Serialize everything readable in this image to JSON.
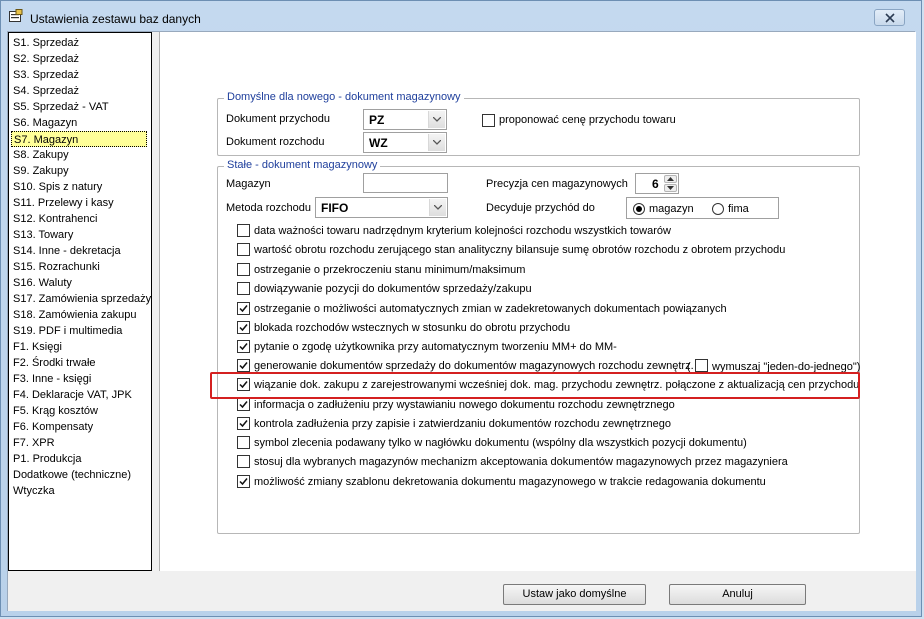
{
  "window": {
    "title": "Ustawienia zestawu baz danych"
  },
  "sections": [
    "S1. Sprzedaż",
    "S2. Sprzedaż",
    "S3. Sprzedaż",
    "S4. Sprzedaż",
    "S5. Sprzedaż - VAT",
    "S6. Magazyn",
    "S7. Magazyn",
    "S8. Zakupy",
    "S9. Zakupy",
    "S10. Spis z natury",
    "S11. Przelewy i kasy",
    "S12. Kontrahenci",
    "S13. Towary",
    "S14. Inne - dekretacja",
    "S15. Rozrachunki",
    "S16. Waluty",
    "S17. Zamówienia sprzedaży",
    "S18. Zamówienia zakupu",
    "S19. PDF i multimedia",
    "F1. Księgi",
    "F2. Środki trwałe",
    "F3. Inne - księgi",
    "F4. Deklaracje VAT, JPK",
    "F5. Krąg kosztów",
    "F6. Kompensaty",
    "F7. XPR",
    "P1. Produkcja",
    "Dodatkowe (techniczne)",
    "Wtyczka"
  ],
  "selected_section": "S7. Magazyn",
  "defaults_group": {
    "legend": "Domyślne dla nowego - dokument magazynowy",
    "income_doc_label": "Dokument przychodu",
    "income_doc_value": "PZ",
    "outgo_doc_label": "Dokument rozchodu",
    "outgo_doc_value": "WZ",
    "propose_price_label": "proponować cenę przychodu towaru"
  },
  "fixed_group": {
    "legend": "Stałe - dokument magazynowy",
    "warehouse_label": "Magazyn",
    "warehouse_value": "",
    "precision_label": "Precyzja cen magazynowych",
    "precision_value": "6",
    "method_label": "Metoda rozchodu",
    "method_value": "FIFO",
    "decides_label": "Decyduje przychód do",
    "radio_warehouse": "magazyn",
    "radio_company": "fima",
    "options": [
      {
        "label": "data ważności towaru nadrzędnym kryterium kolejności rozchodu wszystkich towarów",
        "checked": false
      },
      {
        "label": "wartość obrotu rozchodu zerującego stan analityczny bilansuje sumę obrotów rozchodu z obrotem przychodu",
        "checked": false
      },
      {
        "label": "ostrzeganie o przekroczeniu stanu minimum/maksimum",
        "checked": false
      },
      {
        "label": "dowiązywanie pozycji do dokumentów sprzedaży/zakupu",
        "checked": false
      },
      {
        "label": "ostrzeganie o możliwości automatycznych zmian w zadekretowanych dokumentach powiązanych",
        "checked": true
      },
      {
        "label": "blokada rozchodów wstecznych w stosunku do obrotu przychodu",
        "checked": true
      },
      {
        "label": "pytanie o zgodę użytkownika przy automatycznym tworzeniu MM+ do MM-",
        "checked": true
      },
      {
        "label": "generowanie dokumentów sprzedaży do dokumentów magazynowych rozchodu zewnętrz.",
        "checked": true
      },
      {
        "label": "wiązanie dok. zakupu z zarejestrowanymi wcześniej dok. mag. przychodu zewnętrz. połączone z aktualizacją cen przychodu",
        "checked": true
      },
      {
        "label": "informacja o zadłużeniu przy wystawianiu nowego dokumentu rozchodu zewnętrznego",
        "checked": true
      },
      {
        "label": "kontrola zadłużenia przy zapisie i zatwierdzaniu dokumentów rozchodu zewnętrznego",
        "checked": true
      },
      {
        "label": "symbol zlecenia podawany tylko w nagłówku dokumentu (wspólny dla wszystkich pozycji dokumentu)",
        "checked": false
      },
      {
        "label": "stosuj dla wybranych magazynów mechanizm akceptowania dokumentów magazynowych przez magazyniera",
        "checked": false
      },
      {
        "label": "możliwość zmiany szablonu dekretowania dokumentu magazynowego w trakcie redagowania dokumentu",
        "checked": true
      }
    ],
    "force_one_to_one_open": "(",
    "force_one_to_one_label": "wymuszaj \"jeden-do-jednego\")"
  },
  "buttons": {
    "set_default": "Ustaw jako domyślne",
    "cancel": "Anuluj"
  },
  "colors": {
    "selection": "#ffff99",
    "legend": "#1f3f9c",
    "highlight": "#d42020"
  }
}
